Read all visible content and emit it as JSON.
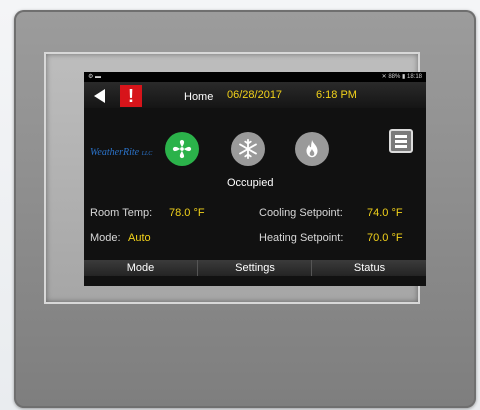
{
  "statusbar": {
    "left": "⚙ ▬",
    "right": "✕ 88% ▮ 18:18"
  },
  "header": {
    "back_icon": "back-arrow-icon",
    "alert_label": "!",
    "title": "Home",
    "date": "06/28/2017",
    "time": "6:18 PM"
  },
  "logo": {
    "name": "WeatherRite",
    "suffix": "LLC"
  },
  "modes": [
    {
      "name": "fan-icon",
      "active": true,
      "color": "#2bb24a"
    },
    {
      "name": "snowflake-icon",
      "active": false,
      "color": "#9a9a9a"
    },
    {
      "name": "flame-icon",
      "active": false,
      "color": "#9a9a9a"
    }
  ],
  "occupancy": "Occupied",
  "readings": {
    "room_temp_label": "Room Temp:",
    "room_temp_value": "78.0 °F",
    "mode_label": "Mode:",
    "mode_value": "Auto",
    "cooling_label": "Cooling Setpoint:",
    "cooling_value": "74.0 °F",
    "heating_label": "Heating Setpoint:",
    "heating_value": "70.0 °F"
  },
  "tabs": {
    "mode": "Mode",
    "settings": "Settings",
    "status": "Status"
  },
  "colors": {
    "accent": "#f2d21a",
    "alert": "#d7141a",
    "active_mode": "#2bb24a"
  }
}
